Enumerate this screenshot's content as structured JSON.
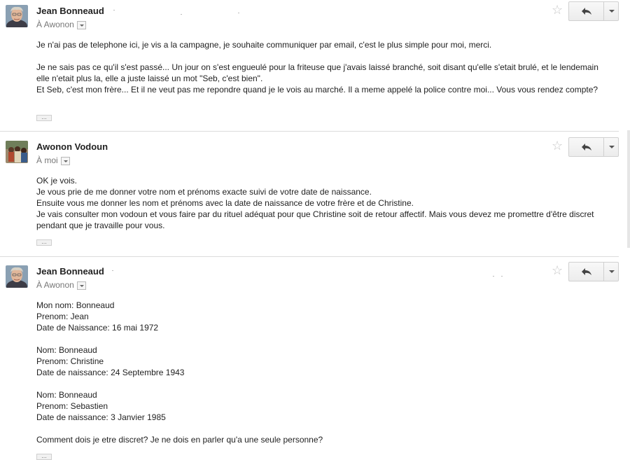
{
  "messages": [
    {
      "sender": "Jean Bonneaud",
      "recipient": "À Awonon",
      "paragraphs": [
        "Je n'ai pas de telephone ici, je vis a la campagne, je souhaite communiquer par email, c'est le plus simple pour moi, merci.",
        "",
        "Je ne sais pas ce qu'il s'est passé... Un jour on s'est engueulé pour la friteuse que j'avais laissé branché, soit disant qu'elle s'etait brulé, et le lendemain elle n'etait plus la, elle a juste laissé un mot \"Seb, c'est bien\".",
        "Et Seb, c'est mon frère... Et il ne veut pas me repondre quand je le vois au marché. Il a meme appelé la police contre moi... Vous vous rendez compte?"
      ],
      "ellipsis": "..."
    },
    {
      "sender": "Awonon Vodoun",
      "recipient": "À moi",
      "paragraphs": [
        "OK je vois.",
        "Je vous prie de me donner votre nom et prénoms exacte suivi de votre date de naissance.",
        "Ensuite vous me donner les nom et prénoms avec la date de naissance de votre frère et de Christine.",
        "Je vais consulter mon vodoun et vous faire par du rituel adéquat pour que Christine soit de retour affectif. Mais vous devez me promettre d'être discret pendant que je travaille pour vous."
      ],
      "ellipsis": "..."
    },
    {
      "sender": "Jean Bonneaud",
      "recipient": "À Awonon",
      "paragraphs": [
        "Mon nom: Bonneaud",
        "Prenom: Jean",
        "Date de Naissance: 16 mai 1972",
        "",
        "Nom: Bonneaud",
        "Prenom: Christine",
        "Date de naissance: 24 Septembre 1943",
        "",
        "Nom: Bonneaud",
        "Prenom: Sebastien",
        "Date de naissance: 3 Janvier 1985",
        "",
        "Comment dois je etre discret? Je ne dois en parler qu'a une seule personne?"
      ],
      "ellipsis": "..."
    }
  ],
  "icons": {
    "star": "star-icon",
    "reply": "reply-arrow-icon",
    "more": "dropdown-arrow-icon"
  },
  "colors": {
    "star": "#c6c6c6",
    "sender": "#222222",
    "recipient": "#777777"
  }
}
